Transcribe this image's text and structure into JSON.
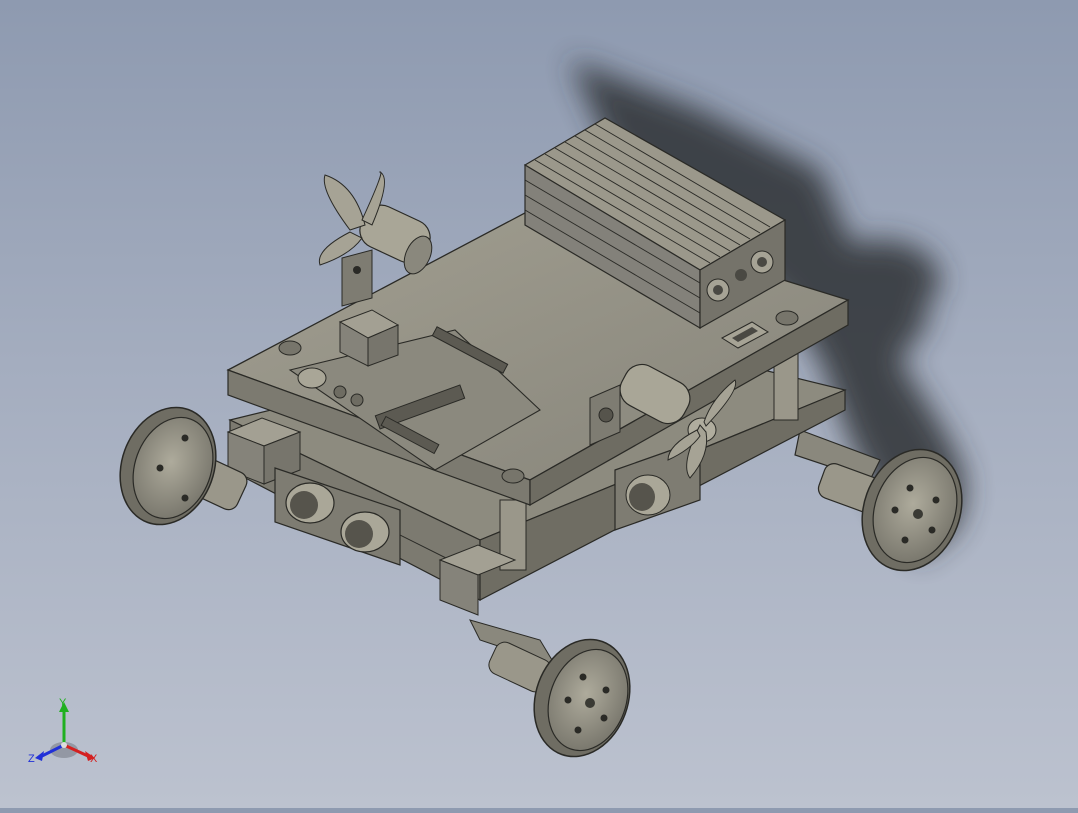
{
  "viewport": {
    "background_top": "#8e9ab0",
    "background_bottom": "#bcc2cf",
    "model_color": "#8f8d80",
    "model_shade": "#6f6d63",
    "model_light": "#b3b0a2",
    "edge_color": "#2a2a26",
    "shadow_color": "#3a3c40"
  },
  "triad": {
    "x_label": "X",
    "y_label": "Y",
    "z_label": "Z",
    "x_color": "#d42020",
    "y_color": "#20b020",
    "z_color": "#2030d8"
  }
}
